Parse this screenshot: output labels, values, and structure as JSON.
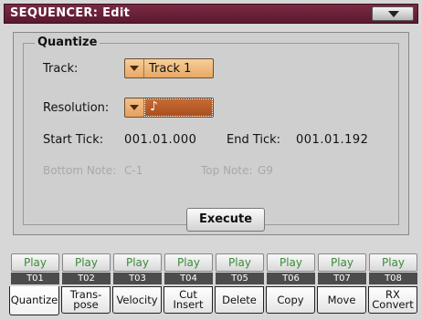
{
  "header": {
    "title": "SEQUENCER: Edit"
  },
  "quantize": {
    "group_label": "Quantize",
    "track_label": "Track:",
    "track_value": "Track 1",
    "resolution_label": "Resolution:",
    "resolution_symbol": "♪",
    "start_tick_label": "Start Tick:",
    "start_tick_value": "001.01.000",
    "end_tick_label": "End Tick:",
    "end_tick_value": "001.01.192",
    "bottom_note_label": "Bottom Note:",
    "bottom_note_value": "C-1",
    "top_note_label": "Top Note:",
    "top_note_value": "G9",
    "execute_label": "Execute"
  },
  "tracks": [
    {
      "play": "Play",
      "name": "T01"
    },
    {
      "play": "Play",
      "name": "T02"
    },
    {
      "play": "Play",
      "name": "T03"
    },
    {
      "play": "Play",
      "name": "T04"
    },
    {
      "play": "Play",
      "name": "T05"
    },
    {
      "play": "Play",
      "name": "T06"
    },
    {
      "play": "Play",
      "name": "T07"
    },
    {
      "play": "Play",
      "name": "T08"
    }
  ],
  "tabs": [
    {
      "line1": "Quantize",
      "line2": ""
    },
    {
      "line1": "Trans-",
      "line2": "pose"
    },
    {
      "line1": "Velocity",
      "line2": ""
    },
    {
      "line1": "Cut",
      "line2": "Insert"
    },
    {
      "line1": "Delete",
      "line2": ""
    },
    {
      "line1": "Copy",
      "line2": ""
    },
    {
      "line1": "Move",
      "line2": ""
    },
    {
      "line1": "RX",
      "line2": "Convert"
    }
  ],
  "colors": {
    "titlebar": "#6a2238",
    "play_text": "#3a8a3a",
    "combo": "#e8a866",
    "resolution_selected": "#b85a28"
  }
}
